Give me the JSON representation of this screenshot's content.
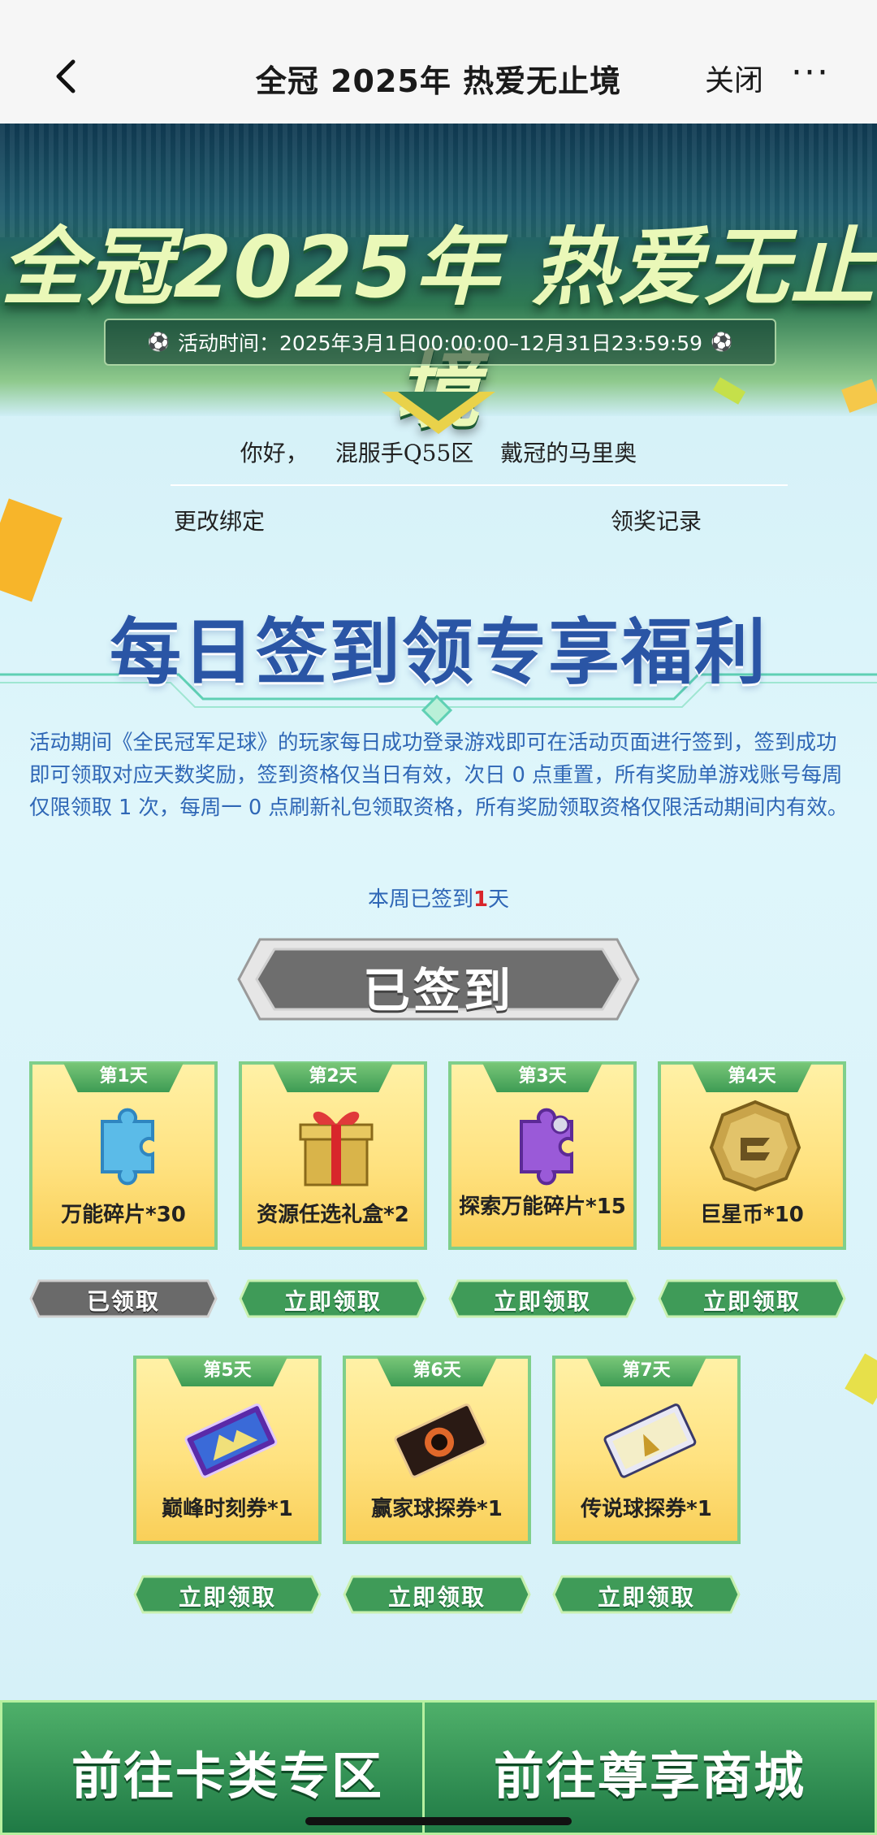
{
  "nav": {
    "title": "全冠 2025年 热爱无止境",
    "close_label": "关闭",
    "more_label": "···"
  },
  "hero": {
    "title": "全冠2025年 热爱无止境",
    "date_label": "活动时间：2025年3月1日00:00:00–12月31日23:59:59"
  },
  "user": {
    "greeting": "你好，",
    "server": "混服手Q55区",
    "nickname": "戴冠的马里奥",
    "change_binding": "更改绑定",
    "reward_record": "领奖记录"
  },
  "signin": {
    "title": "每日签到领专享福利",
    "description": "活动期间《全民冠军足球》的玩家每日成功登录游戏即可在活动页面进行签到，签到成功即可领取对应天数奖励，签到资格仅当日有效，次日 0 点重置，所有奖励单游戏账号每周仅限领取 1 次，每周一 0 点刷新礼包领取资格，所有奖励领取资格仅限活动期间内有效。",
    "week_prefix": "本周已签到",
    "week_count": "1",
    "week_suffix": "天",
    "signed_label": "已签到"
  },
  "rewards": [
    {
      "day": "第1天",
      "name": "万能碎片*30",
      "claim": "已领取",
      "icon": "blue-puzzle-icon",
      "claimed": true
    },
    {
      "day": "第2天",
      "name": "资源任选礼盒*2",
      "claim": "立即领取",
      "icon": "gift-box-icon",
      "claimed": false
    },
    {
      "day": "第3天",
      "name": "探索万能碎片*15",
      "claim": "立即领取",
      "icon": "purple-puzzle-icon",
      "claimed": false
    },
    {
      "day": "第4天",
      "name": "巨星币*10",
      "claim": "立即领取",
      "icon": "gold-coin-icon",
      "claimed": false
    },
    {
      "day": "第5天",
      "name": "巅峰时刻券*1",
      "claim": "立即领取",
      "icon": "peak-ticket-icon",
      "claimed": false
    },
    {
      "day": "第6天",
      "name": "赢家球探券*1",
      "claim": "立即领取",
      "icon": "winner-ticket-icon",
      "claimed": false
    },
    {
      "day": "第7天",
      "name": "传说球探券*1",
      "claim": "立即领取",
      "icon": "legend-ticket-icon",
      "claimed": false
    }
  ],
  "bottom": {
    "hint": "",
    "card_zone": "前往卡类专区",
    "vip_shop": "前往尊享商城"
  }
}
